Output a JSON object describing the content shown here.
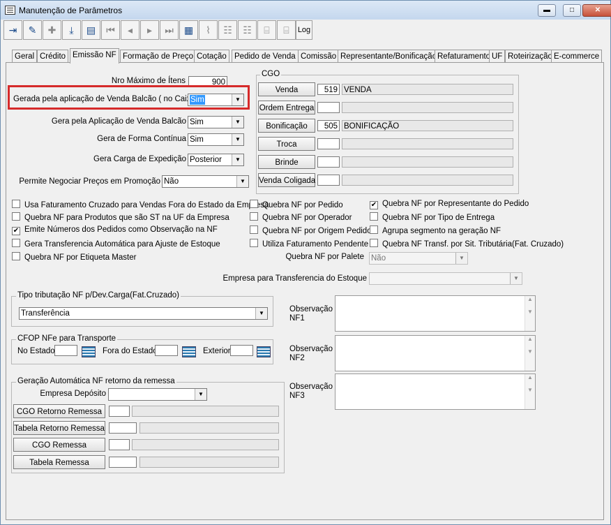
{
  "window": {
    "title": "Manutenção de Parâmetros",
    "minimize": "▬",
    "maximize": "□",
    "close": "✕"
  },
  "toolbar": {
    "icons": [
      "exit-icon",
      "edit-icon",
      "new-record-icon",
      "download-icon",
      "save-icon",
      "first-icon",
      "prev-icon",
      "next-icon",
      "last-icon",
      "grid-icon",
      "chart-icon",
      "table-icon",
      "table-add-icon",
      "tree-icon",
      "branch-icon"
    ],
    "log_label": "Log"
  },
  "tabs": [
    "Geral",
    "Crédito",
    "Emissão NF",
    "Formação de Preço",
    "Cotação",
    "Pedido de Venda",
    "Comissão",
    "Representante/Bonificação",
    "Refaturamento",
    "UF",
    "Roteirização",
    "E-commerce"
  ],
  "active_tab": "Emissão NF",
  "fields": {
    "nro_max_itens": {
      "label": "Nro Máximo de Ítens",
      "value": "900"
    },
    "gerada_venda_balcao": {
      "label": "Gerada pela aplicação de Venda Balcão ( no Caixa )",
      "value": "Sim"
    },
    "gera_aplicacao_venda_balcao": {
      "label": "Gera pela Aplicação de Venda Balcão",
      "value": "Sim"
    },
    "gera_forma_continua": {
      "label": "Gera de Forma Contínua",
      "value": "Sim"
    },
    "gera_carga_expedicao": {
      "label": "Gera Carga de Expedição",
      "value": "Posterior"
    },
    "permite_negociar": {
      "label": "Permite Negociar Preços em Promoção",
      "value": "Não"
    }
  },
  "cgo": {
    "title": "CGO",
    "rows": [
      {
        "button": "Venda",
        "code": "519",
        "desc": "VENDA"
      },
      {
        "button": "Ordem Entrega",
        "code": "",
        "desc": ""
      },
      {
        "button": "Bonificação",
        "code": "505",
        "desc": "BONIFICAÇÃO"
      },
      {
        "button": "Troca",
        "code": "",
        "desc": ""
      },
      {
        "button": "Brinde",
        "code": "",
        "desc": ""
      },
      {
        "button": "Venda Coligada",
        "code": "",
        "desc": ""
      }
    ]
  },
  "checkboxes": {
    "col1": [
      {
        "label": "Usa Faturamento Cruzado para Vendas Fora do Estado da Empresa",
        "checked": false
      },
      {
        "label": "Quebra NF para Produtos que são ST na UF da Empresa",
        "checked": false
      },
      {
        "label": "Emite Números dos Pedidos como Observação na NF",
        "checked": true
      },
      {
        "label": "Gera Transferencia Automática para Ajuste de Estoque",
        "checked": false
      },
      {
        "label": "Quebra NF por Etiqueta Master",
        "checked": false
      }
    ],
    "col2": [
      {
        "label": "Quebra NF por Pedido",
        "checked": false
      },
      {
        "label": "Quebra NF por Operador",
        "checked": false
      },
      {
        "label": "Quebra NF por Origem Pedido",
        "checked": false
      },
      {
        "label": "Utiliza Faturamento Pendente",
        "checked": false
      }
    ],
    "col3": [
      {
        "label": "Quebra NF por Representante do Pedido",
        "checked": true
      },
      {
        "label": "Quebra NF por Tipo de Entrega",
        "checked": false
      },
      {
        "label": "Agrupa segmento na geração NF",
        "checked": false
      },
      {
        "label": "Quebra NF Transf. por Sit. Tributária(Fat. Cruzado)",
        "checked": false
      }
    ]
  },
  "quebra_palete": {
    "label": "Quebra NF por Palete",
    "value": "Não"
  },
  "empresa_transf": {
    "label": "Empresa para Transferencia do Estoque",
    "value": ""
  },
  "tipo_tributacao": {
    "title": "Tipo tributação NF p/Dev.Carga(Fat.Cruzado)",
    "value": "Transferência"
  },
  "cfop": {
    "title": "CFOP NFe para Transporte",
    "no_estado": "No Estado",
    "fora_estado": "Fora do Estado",
    "exterior": "Exterior"
  },
  "geracao": {
    "title": "Geração Automática NF retorno da remessa",
    "empresa_label": "Empresa Depósito",
    "buttons": [
      "CGO Retorno Remessa",
      "Tabela Retorno Remessa",
      "CGO Remessa",
      "Tabela Remessa"
    ]
  },
  "observacoes": [
    {
      "label": "Observação NF1"
    },
    {
      "label": "Observação NF2"
    },
    {
      "label": "Observação NF3"
    }
  ],
  "highlight_color": "#d62a2a"
}
